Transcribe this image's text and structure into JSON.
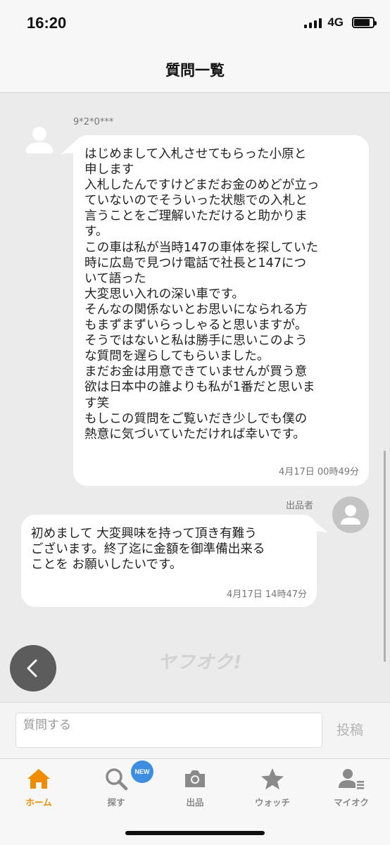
{
  "status_bar": {
    "time": "16:20",
    "network": "4G"
  },
  "header": {
    "title": "質問一覧"
  },
  "messages": [
    {
      "sender": "9*2*0***",
      "text": "はじめまして入札させてもらった小原と\n申します\n入札したんですけどまだお金のめどが立っ\nていないのでそういった状態での入札と\n言うことをご理解いただけると助かりま\nす。\nこの車は私が当時147の車体を探していた\n時に広島で見つけ電話で社長と147につ\nいて語った\n大変思い入れの深い車です。\nそんなの関係ないとお思いになられる方\nもまずまずいらっしゃると思いますが。\nそうではないと私は勝手に思いこのよう\nな質問を遅らしてもらいました。\nまだお金は用意できていませんが買う意\n欲は日本中の誰よりも私が1番だと思いま\nす笑\nもしこの質問をご覧いだき少しでも僕の\n熱意に気づいていただければ幸いです。",
      "timestamp": "4月17日 00時49分"
    },
    {
      "sender": "出品者",
      "text": "初めまして 大変興味を持って頂き有難う\nございます。終了迄に金額を御準備出来る\nことを お願いしたいです。",
      "timestamp": "4月17日 14時47分"
    }
  ],
  "logo_text": "ヤフオク!",
  "input": {
    "placeholder": "質問する",
    "post_label": "投稿"
  },
  "tabs": [
    {
      "label": "ホーム",
      "icon": "home-icon",
      "active": true
    },
    {
      "label": "探す",
      "icon": "search-icon",
      "badge": "NEW"
    },
    {
      "label": "出品",
      "icon": "camera-icon"
    },
    {
      "label": "ウォッチ",
      "icon": "star-icon"
    },
    {
      "label": "マイオク",
      "icon": "user-list-icon"
    }
  ],
  "colors": {
    "accent": "#f08c00",
    "badge": "#3d8de0",
    "background": "#ebebeb"
  }
}
